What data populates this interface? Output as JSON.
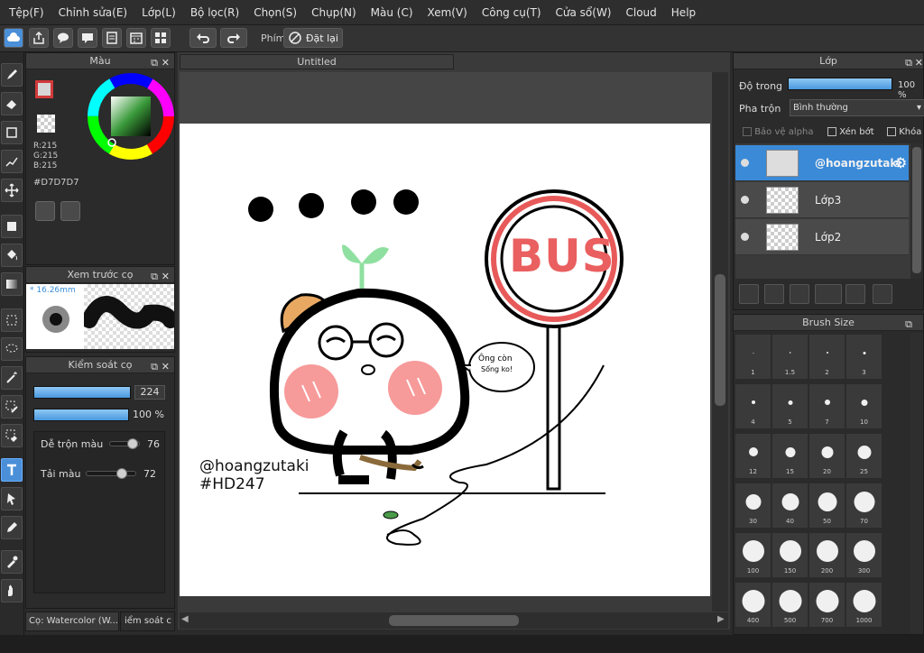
{
  "menu": [
    "Tệp(F)",
    "Chỉnh sửa(E)",
    "Lớp(L)",
    "Bộ lọc(R)",
    "Chọn(S)",
    "Chụp(N)",
    "Màu (C)",
    "Xem(V)",
    "Công cụ(T)",
    "Cửa sổ(W)",
    "Cloud",
    "Help"
  ],
  "toolbar": {
    "phim_label": "Phím",
    "reset_label": "Đặt lại"
  },
  "color_panel": {
    "title": "Màu",
    "r": "R:215",
    "g": "G:215",
    "b": "B:215",
    "hex": "#D7D7D7",
    "main_color": "#d7d7d7",
    "accent_border": "#d33a3a"
  },
  "brush_preview": {
    "title": "Xem trước cọ",
    "size": "16.26mm"
  },
  "brush_control": {
    "title": "Kiểm soát cọ",
    "size_value": "224",
    "opacity_value": "100 %",
    "blend_label": "Dễ trộn màu",
    "blend_value": "76",
    "blend_level": 0.76,
    "reload_label": "Tải màu",
    "reload_value": "72",
    "reload_level": 0.72
  },
  "bottom_tabs": {
    "tab1": "Cọ: Watercolor (W...",
    "tab2": "iểm soát c"
  },
  "canvas": {
    "tab_title": "Untitled",
    "sign_text": "BUS",
    "bubble_line1": "Ông còn",
    "bubble_line2": "Sống ko!",
    "signature_line1": "@hoangzutaki",
    "signature_line2": "#HD247"
  },
  "layer_panel": {
    "title": "Lớp",
    "opacity_label": "Độ trong",
    "opacity_value": "100 %",
    "blend_label": "Pha trộn",
    "blend_mode": "Bình thường",
    "protect_alpha": "Bảo vệ alpha",
    "clipping": "Xén bớt",
    "lock": "Khóa",
    "layers": [
      {
        "name": "@hoangzutaki",
        "selected": true
      },
      {
        "name": "Lớp3",
        "selected": false
      },
      {
        "name": "Lớp2",
        "selected": false
      }
    ]
  },
  "brush_size": {
    "title": "Brush Size",
    "sizes": [
      "1",
      "1.5",
      "2",
      "3",
      "4",
      "5",
      "7",
      "10",
      "12",
      "15",
      "20",
      "25",
      "30",
      "40",
      "50",
      "70",
      "100",
      "150",
      "200",
      "300",
      "400",
      "500",
      "700",
      "1000"
    ]
  }
}
